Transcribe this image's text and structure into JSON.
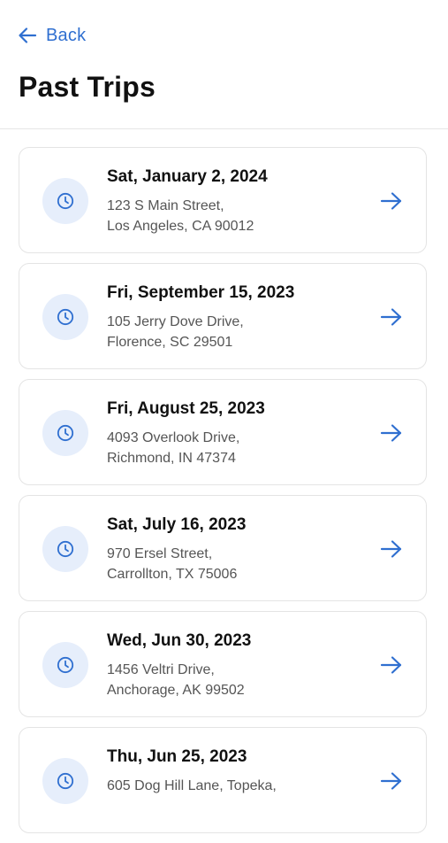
{
  "header": {
    "back_label": "Back",
    "title": "Past Trips"
  },
  "colors": {
    "accent": "#2f6fd0",
    "icon_bg": "#e6eefb"
  },
  "icons": {
    "back": "arrow-left-icon",
    "trip": "clock-icon",
    "open": "arrow-right-icon"
  },
  "trips": [
    {
      "date": "Sat, January 2, 2024",
      "address_line1": "123 S Main Street,",
      "address_line2": "Los Angeles, CA 90012"
    },
    {
      "date": "Fri, September 15, 2023",
      "address_line1": "105 Jerry Dove Drive,",
      "address_line2": "Florence, SC 29501"
    },
    {
      "date": "Fri, August 25, 2023",
      "address_line1": "4093 Overlook Drive,",
      "address_line2": "Richmond, IN 47374"
    },
    {
      "date": "Sat, July 16, 2023",
      "address_line1": "970 Ersel Street,",
      "address_line2": "Carrollton, TX 75006"
    },
    {
      "date": "Wed, Jun 30, 2023",
      "address_line1": "1456 Veltri Drive,",
      "address_line2": "Anchorage, AK 99502"
    },
    {
      "date": "Thu, Jun 25, 2023",
      "address_line1": "605 Dog Hill Lane, Topeka,",
      "address_line2": ""
    }
  ]
}
